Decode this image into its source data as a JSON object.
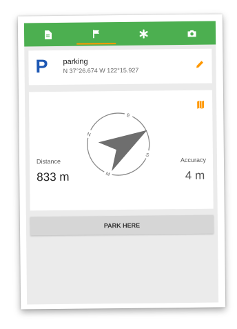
{
  "tabs": [
    {
      "icon": "document-icon",
      "active": false
    },
    {
      "icon": "flag-icon",
      "active": true
    },
    {
      "icon": "asterisk-icon",
      "active": false
    },
    {
      "icon": "camera-icon",
      "active": false
    }
  ],
  "location": {
    "badge": "P",
    "name": "parking",
    "coords": "N 37°26.674 W 122°15.927"
  },
  "compass": {
    "north": "N",
    "east": "E",
    "south": "S",
    "west": "M"
  },
  "distance": {
    "label": "Distance",
    "value": "833 m"
  },
  "accuracy": {
    "label": "Accuracy",
    "value": "4 m"
  },
  "park_button": "PARK HERE",
  "colors": {
    "accent_green": "#4caf50",
    "accent_orange": "#ff9800",
    "badge_blue": "#1e58b4"
  }
}
